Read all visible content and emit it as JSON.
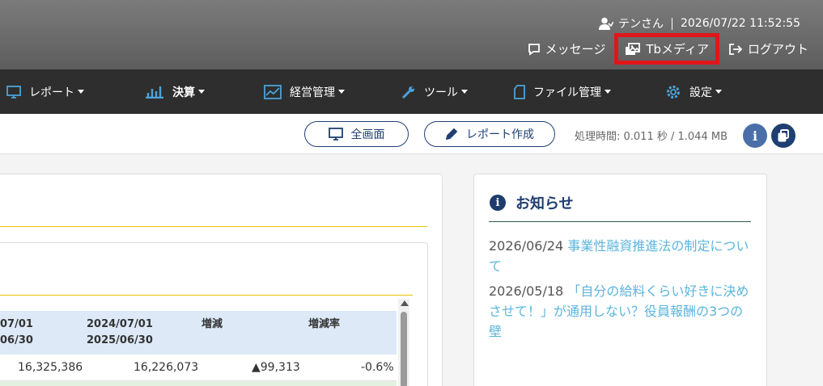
{
  "header": {
    "user_name": "テンさん",
    "datetime": "2026/07/22 11:52:55",
    "links": {
      "message": "メッセージ",
      "tbmedia": "Tbメディア",
      "logout": "ログアウト"
    },
    "highlight_color": "#e0161b"
  },
  "nav": {
    "items": [
      {
        "label": "レポート",
        "icon": "monitor-icon"
      },
      {
        "label": "決算",
        "icon": "bar-chart-icon"
      },
      {
        "label": "経営管理",
        "icon": "line-chart-icon"
      },
      {
        "label": "ツール",
        "icon": "wrench-icon"
      },
      {
        "label": "ファイル管理",
        "icon": "file-icon"
      },
      {
        "label": "設定",
        "icon": "gear-icon"
      }
    ]
  },
  "toolbar": {
    "fullscreen_label": "全画面",
    "report_create_label": "レポート作成",
    "processing_time": "処理時間: 0.011 秒 / 1.044 MB",
    "info_btn": "i"
  },
  "table": {
    "headers": {
      "col1_line1": "07/01",
      "col1_line2": "06/30",
      "col2_line1": "2024/07/01",
      "col2_line2": "2025/06/30",
      "col3": "増減",
      "col4": "増減率"
    },
    "row1": {
      "v1": "16,325,386",
      "v2": "16,226,073",
      "v3": "▲99,313",
      "v4": "-0.6%"
    }
  },
  "notice": {
    "title": "お知らせ",
    "items": [
      {
        "date": "2026/06/24",
        "text": "事業性融資推進法の制定について"
      },
      {
        "date": "2026/05/18",
        "text": "「自分の給料くらい好きに決めさせて！」が通用しない？役員報酬の3つの壁"
      }
    ]
  },
  "colors": {
    "nav_icon": "#4ba3d9",
    "brand_navy": "#1f3f72",
    "link": "#5bb5dc",
    "accent_line": "#e8c400"
  }
}
